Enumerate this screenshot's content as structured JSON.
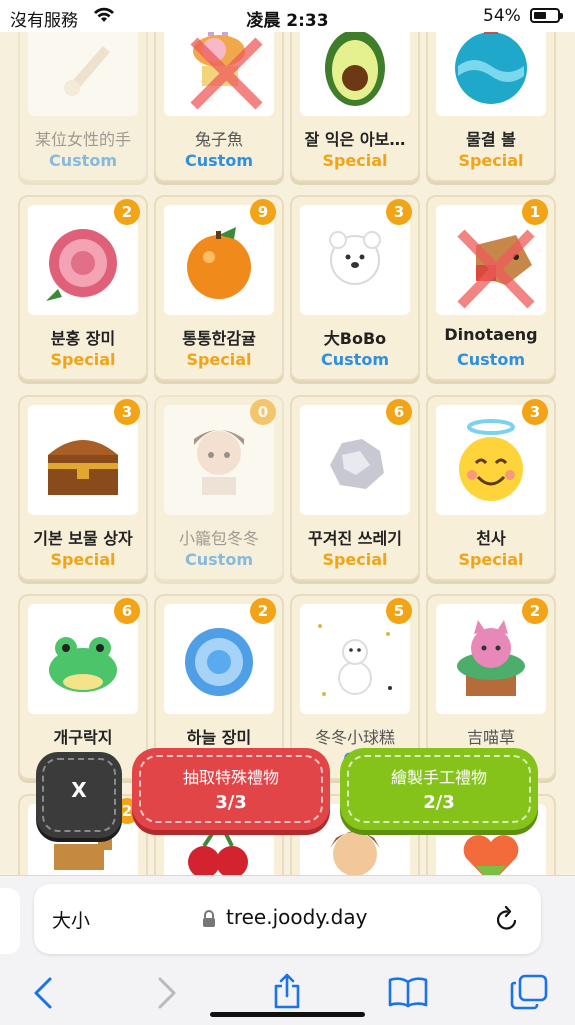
{
  "status_bar": {
    "carrier": "沒有服務",
    "time": "凌晨 2:33",
    "battery": "54%",
    "battery_level": 0.54
  },
  "gifts": [
    {
      "name": "某位女性的手",
      "type": "Custom",
      "count": "",
      "faded": true,
      "crossed": false,
      "icon": "hand-icon"
    },
    {
      "name": "兔子魚",
      "type": "Custom",
      "count": "",
      "faded": false,
      "crossed": true,
      "icon": "bunny-fish-icon"
    },
    {
      "name": "잘 익은 아보…",
      "type": "Special",
      "count": "",
      "faded": false,
      "crossed": false,
      "icon": "avocado-icon"
    },
    {
      "name": "물결 볼",
      "type": "Special",
      "count": "",
      "faded": false,
      "crossed": false,
      "icon": "wave-ball-icon"
    },
    {
      "name": "분홍 장미",
      "type": "Special",
      "count": "2",
      "faded": false,
      "crossed": false,
      "icon": "pink-rose-icon"
    },
    {
      "name": "통통한감귤",
      "type": "Special",
      "count": "9",
      "faded": false,
      "crossed": false,
      "icon": "tangerine-icon"
    },
    {
      "name": "大BoBo",
      "type": "Custom",
      "count": "3",
      "faded": false,
      "crossed": false,
      "icon": "bear-icon"
    },
    {
      "name": "Dinotaeng",
      "type": "Custom",
      "count": "1",
      "faded": false,
      "crossed": true,
      "icon": "dinotaeng-icon"
    },
    {
      "name": "기본 보물 상자",
      "type": "Special",
      "count": "3",
      "faded": false,
      "crossed": false,
      "icon": "treasure-chest-icon"
    },
    {
      "name": "小籠包冬冬",
      "type": "Custom",
      "count": "0",
      "faded": true,
      "crossed": false,
      "icon": "person-icon"
    },
    {
      "name": "꾸겨진 쓰레기",
      "type": "Special",
      "count": "6",
      "faded": false,
      "crossed": false,
      "icon": "crumpled-paper-icon"
    },
    {
      "name": "천사",
      "type": "Special",
      "count": "3",
      "faded": false,
      "crossed": false,
      "icon": "angel-face-icon"
    },
    {
      "name": "개구락지",
      "type": "",
      "count": "6",
      "faded": false,
      "crossed": false,
      "icon": "frog-icon"
    },
    {
      "name": "하늘 장미",
      "type": "",
      "count": "2",
      "faded": false,
      "crossed": false,
      "icon": "blue-rose-icon"
    },
    {
      "name": "冬冬小球糕",
      "type": "Cu",
      "count": "5",
      "faded": false,
      "crossed": false,
      "icon": "snowman-icon"
    },
    {
      "name": "吉喵草",
      "type": "",
      "count": "2",
      "faded": false,
      "crossed": false,
      "icon": "cat-plant-icon"
    },
    {
      "name": "",
      "type": "",
      "count": "2",
      "faded": false,
      "crossed": false,
      "icon": "deer-icon"
    },
    {
      "name": "",
      "type": "",
      "count": "",
      "faded": false,
      "crossed": false,
      "icon": "cherry-icon"
    },
    {
      "name": "",
      "type": "",
      "count": "",
      "faded": false,
      "crossed": false,
      "icon": "boy-icon"
    },
    {
      "name": "",
      "type": "",
      "count": "",
      "faded": false,
      "crossed": false,
      "icon": "rainbow-heart-icon"
    }
  ],
  "buttons": {
    "close": "X",
    "draw_special": {
      "label": "抽取特殊禮物",
      "count": "3/3"
    },
    "draw_custom": {
      "label": "繪製手工禮物",
      "count": "2/3"
    }
  },
  "browser": {
    "text_size": "大小",
    "url": "tree.joody.day"
  },
  "colors": {
    "special": "#f2a416",
    "custom": "#2f8fe0",
    "badge": "#f2a416",
    "red_button": "#e24548",
    "green_button": "#85c31b"
  }
}
